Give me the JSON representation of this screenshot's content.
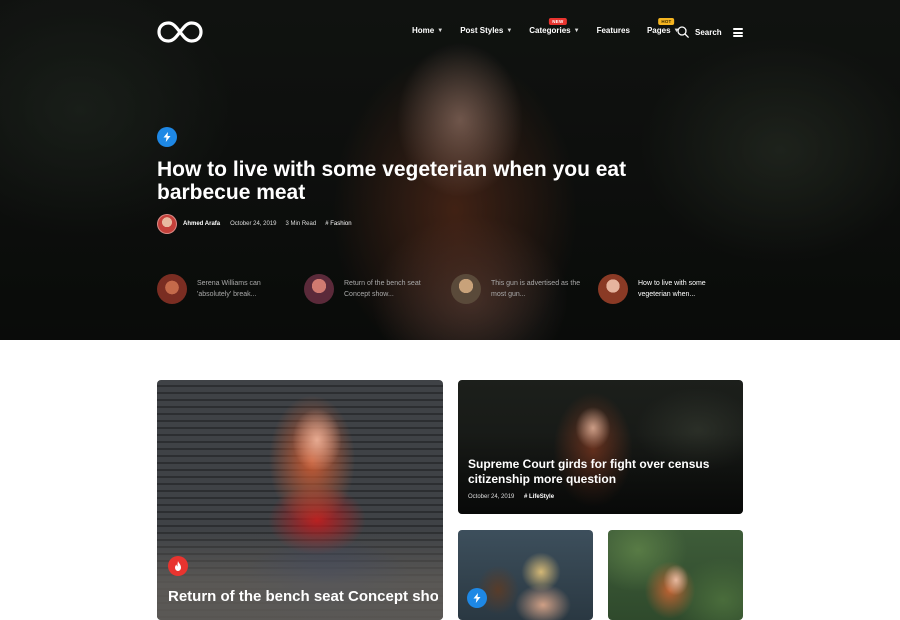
{
  "nav": {
    "logo_icon": "infinity-logo-icon",
    "items": [
      {
        "label": "Home",
        "has_dropdown": true
      },
      {
        "label": "Post Styles",
        "has_dropdown": true
      },
      {
        "label": "Categories",
        "has_dropdown": true,
        "badge": "NEW"
      },
      {
        "label": "Features",
        "has_dropdown": false
      },
      {
        "label": "Pages",
        "has_dropdown": true,
        "badge": "HOT"
      }
    ],
    "search_label": "Search"
  },
  "hero": {
    "category_icon": "bolt-icon",
    "title": "How to live with some vegeterian when you eat barbecue meat",
    "author": "Ahmed Arafa",
    "date": "October 24, 2019",
    "read_time": "3 Min Read",
    "tag": "# Fashion"
  },
  "related": [
    {
      "text": "Serena Williams can 'absolutely' break..."
    },
    {
      "text": "Return of the bench seat Concept show..."
    },
    {
      "text": "This gun is advertised as the most gun..."
    },
    {
      "text": "How to live with some vegeterian when..."
    }
  ],
  "cards": {
    "big": {
      "icon": "fire-icon",
      "title": "Return of the bench seat Concept show"
    },
    "wide": {
      "title": "Supreme Court girds for fight over census citizenship more question",
      "date": "October 24, 2019",
      "tag": "# LifeStyle"
    },
    "small1": {
      "icon": "bolt-icon"
    }
  },
  "colors": {
    "accent_blue": "#1e88e5",
    "accent_red": "#e8342f",
    "badge_hot": "#f5b521"
  }
}
